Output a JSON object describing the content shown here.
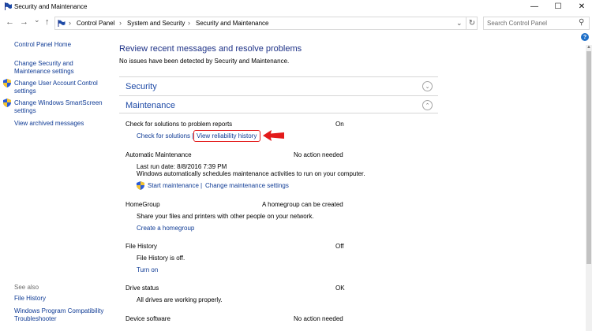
{
  "window": {
    "title": "Security and Maintenance",
    "minimize_glyph": "—",
    "maximize_glyph": "☐",
    "close_glyph": "✕"
  },
  "nav": {
    "back_glyph": "←",
    "forward_glyph": "→",
    "recent_glyph": "⌄",
    "up_glyph": "↑",
    "breadcrumb": [
      "Control Panel",
      "System and Security",
      "Security and Maintenance"
    ],
    "separator": "›",
    "address_dropdown_glyph": "⌄",
    "refresh_glyph": "↻",
    "search_placeholder": "Search Control Panel",
    "search_glyph": "⚲",
    "help_glyph": "?"
  },
  "sidebar": {
    "home": "Control Panel Home",
    "links": [
      {
        "label": "Change Security and Maintenance settings",
        "shield": false
      },
      {
        "label": "Change User Account Control settings",
        "shield": true
      },
      {
        "label": "Change Windows SmartScreen settings",
        "shield": true
      },
      {
        "label": "View archived messages",
        "shield": false
      }
    ],
    "see_also_heading": "See also",
    "see_also": [
      "File History",
      "Windows Program Compatibility Troubleshooter"
    ]
  },
  "main": {
    "heading": "Review recent messages and resolve problems",
    "description": "No issues have been detected by Security and Maintenance.",
    "security_title": "Security",
    "security_expander": "⌄",
    "maintenance_title": "Maintenance",
    "maintenance_expander": "⌃",
    "problem_reports": {
      "label": "Check for solutions to problem reports",
      "status": "On",
      "link_check": "Check for solutions",
      "link_reliability": "View reliability history"
    },
    "automatic_maintenance": {
      "label": "Automatic Maintenance",
      "status": "No action needed",
      "last_run": "Last run date: 8/8/2016 7:39 PM",
      "info": "Windows automatically schedules maintenance activities to run on your computer.",
      "link_start": "Start maintenance",
      "link_settings": "Change maintenance settings",
      "link_separator": "|"
    },
    "homegroup": {
      "label": "HomeGroup",
      "status": "A homegroup can be created",
      "info": "Share your files and printers with other people on your network.",
      "link": "Create a homegroup"
    },
    "file_history": {
      "label": "File History",
      "status": "Off",
      "info": "File History is off.",
      "link": "Turn on"
    },
    "drive_status": {
      "label": "Drive status",
      "status": "OK",
      "info": "All drives are working properly."
    },
    "device_software": {
      "label": "Device software",
      "status": "No action needed"
    }
  },
  "colors": {
    "link": "#0f3b95",
    "heading": "#1e3287",
    "section_title": "#1e4aa6",
    "annotation_red": "#e31a1a"
  }
}
